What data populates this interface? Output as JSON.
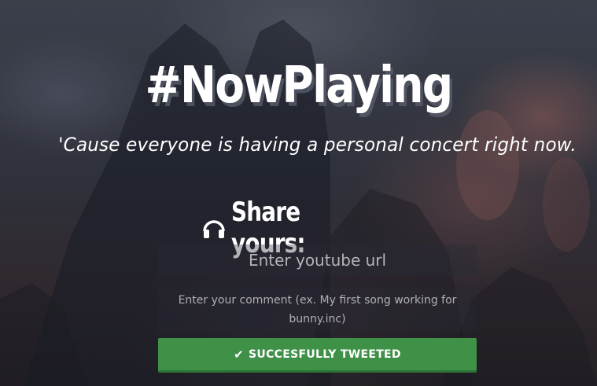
{
  "hero": {
    "title": "#NowPlaying",
    "tagline": "'Cause everyone is having a personal concert right now.",
    "share_label": "Share yours:",
    "share_icon": "headphones-icon"
  },
  "form": {
    "url_placeholder": "Enter youtube url",
    "comment_placeholder": "Enter your comment (ex. My first song working for bunny.inc)",
    "button_label": "SUCCESFULLY TWEETED",
    "button_icon": "check-icon"
  },
  "colors": {
    "button_bg": "#3e9147",
    "text": "#ffffff"
  }
}
